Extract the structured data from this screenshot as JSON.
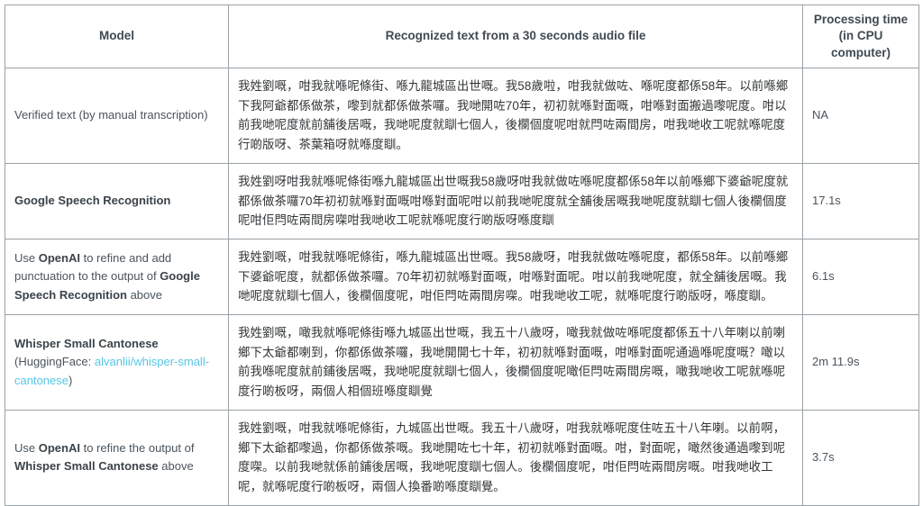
{
  "table": {
    "headers": {
      "model": "Model",
      "recognized_text": "Recognized text from a 30 seconds audio file",
      "processing_time": "Processing time (in CPU computer)",
      "processing_time_line1": "Processing time",
      "processing_time_line2": "(in CPU",
      "processing_time_line3": "computer)"
    },
    "rows": [
      {
        "model_plain": "Verified text (by manual transcription)",
        "model_parts": [
          {
            "text": "Verified text (by manual transcription)",
            "style": "normal"
          }
        ],
        "recognized_text": "我姓劉嘅，咁我就喺呢條街、喺九龍城區出世嘅。我58歲啦，咁我就做咗、喺呢度都係58年。以前喺鄉下我阿爺都係做茶，嚟到就都係做茶囉。我哋開咗70年，初初就喺對面嘅，咁喺對面搬過嚟呢度。咁以前我哋呢度就前舖後居嘅，我哋呢度就瞓七個人，後欄個度呢咁就閂咗兩間房，咁我哋收工呢就喺呢度行啲版呀、茶葉箱呀就喺度瞓。",
        "processing_time": "NA"
      },
      {
        "model_plain": "Google Speech Recognition",
        "model_parts": [
          {
            "text": "Google Speech Recognition",
            "style": "bold"
          }
        ],
        "recognized_text": "我姓劉呀咁我就喺呢條街喺九龍城區出世嘅我58歲呀咁我就做咗喺呢度都係58年以前喺鄉下婆爺呢度就都係做茶囉70年初初就喺對面嘅咁喺對面呢咁以前我哋呢度就全舖後居嘅我哋呢度就瞓七個人後欄個度呢咁佢閂咗兩間房㗎咁我哋收工呢就喺呢度行啲版呀喺度瞓",
        "processing_time": "17.1s"
      },
      {
        "model_plain": "Use OpenAI to refine and add punctuation to the output of Google Speech Recognition above",
        "model_parts": [
          {
            "text": "Use ",
            "style": "normal"
          },
          {
            "text": "OpenAI",
            "style": "bold"
          },
          {
            "text": " to refine and add punctuation to the output of ",
            "style": "normal"
          },
          {
            "text": "Google Speech Recognition",
            "style": "bold"
          },
          {
            "text": " above",
            "style": "normal"
          }
        ],
        "recognized_text": "我姓劉嘅，咁我就喺呢條街，喺九龍城區出世嘅。我58歲呀，咁我就做咗喺呢度，都係58年。以前喺鄉下婆爺呢度，就都係做茶囉。70年初初就喺對面嘅，咁喺對面呢。咁以前我哋呢度，就全舖後居嘅。我哋呢度就瞓七個人，後欄個度呢，咁佢閂咗兩間房㗎。咁我哋收工呢，就喺呢度行啲版呀，喺度瞓。",
        "processing_time": "6.1s"
      },
      {
        "model_plain": "Whisper Small Cantonese (HuggingFace: alvanlii/whisper-small-cantonese)",
        "model_parts": [
          {
            "text": "Whisper Small Cantonese",
            "style": "bold"
          },
          {
            "text": " (HuggingFace: ",
            "style": "normal"
          },
          {
            "text": "alvanlii/whisper-small-cantonese",
            "style": "link"
          },
          {
            "text": ")",
            "style": "normal"
          }
        ],
        "recognized_text": "我姓劉嘅，噉我就喺呢條街喺九城區出世嘅，我五十八歲呀，噉我就做咗喺呢度都係五十八年喇以前喇鄉下太爺都喇到，你都係做茶囉，我哋開開七十年，初初就喺對面嘅，咁喺對面呢通過喺呢度嘅？噉以前我喺呢度就前鋪後居嘅，我哋呢度就瞓七個人，後欄個度呢噉佢閂咗兩間房嘅，噉我哋收工呢就喺呢度行啲板呀，兩個人相個班喺度瞓覺",
        "processing_time": "2m 11.9s"
      },
      {
        "model_plain": "Use OpenAI to refine the output of Whisper Small Cantonese above",
        "model_parts": [
          {
            "text": "Use ",
            "style": "normal"
          },
          {
            "text": "OpenAI",
            "style": "bold"
          },
          {
            "text": " to refine the output of ",
            "style": "normal"
          },
          {
            "text": "Whisper Small Cantonese",
            "style": "bold"
          },
          {
            "text": " above",
            "style": "normal"
          }
        ],
        "recognized_text": "我姓劉嘅，咁我就喺呢條街，九城區出世嘅。我五十八歲呀，咁我就喺呢度住咗五十八年喇。以前啊，鄉下太爺都嚟過，你都係做茶嘅。我哋開咗七十年，初初就喺對面嘅。咁，對面呢，噉然後通過嚟到呢度㗎。以前我哋就係前鋪後居嘅，我哋呢度瞓七個人。後欄個度呢，咁佢閂咗兩間房嘅。咁我哋收工呢，就喺呢度行啲板呀，兩個人換番啲喺度瞓覺。",
        "processing_time": "3.7s"
      }
    ]
  },
  "colors": {
    "border": "#9aa1a6",
    "header_rule": "#2f3436",
    "text": "#4a545c",
    "text_cjk": "#333638",
    "link": "#56c6e4",
    "background": "#ffffff"
  }
}
